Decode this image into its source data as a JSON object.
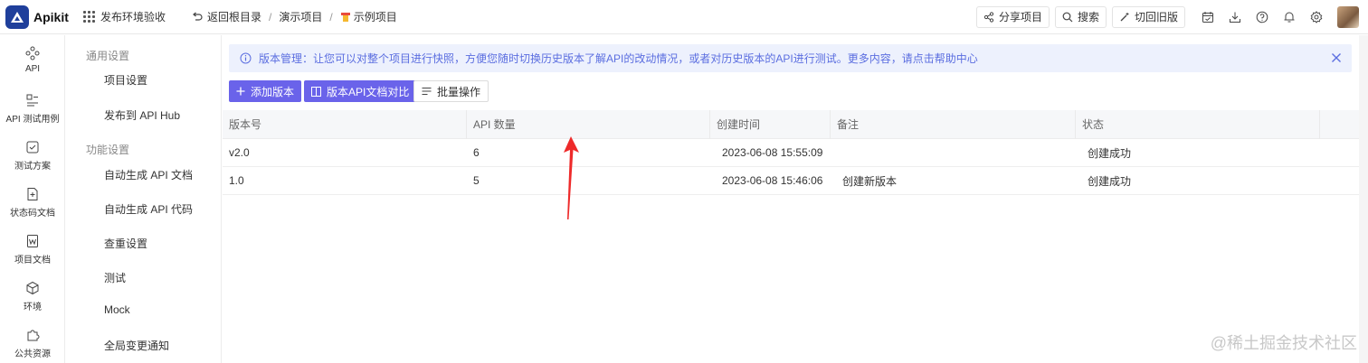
{
  "app": {
    "name": "Apikit"
  },
  "topbar": {
    "env": "发布环境验收",
    "back": "返回根目录",
    "breadcrumb": [
      "演示项目",
      "示例项目"
    ],
    "share": "分享项目",
    "search": "搜索",
    "switch_old": "切回旧版"
  },
  "rail": [
    {
      "label": "API",
      "icon": "api-icon"
    },
    {
      "label": "API 测试用例",
      "icon": "test-case-icon"
    },
    {
      "label": "测试方案",
      "icon": "test-plan-icon"
    },
    {
      "label": "状态码文档",
      "icon": "status-code-icon"
    },
    {
      "label": "项目文档",
      "icon": "word-doc-icon"
    },
    {
      "label": "环境",
      "icon": "environment-icon"
    },
    {
      "label": "公共资源",
      "icon": "puzzle-icon"
    }
  ],
  "settings": {
    "general_title": "通用设置",
    "general": [
      "项目设置",
      "发布到 API Hub"
    ],
    "feature_title": "功能设置",
    "feature": [
      "自动生成 API 文档",
      "自动生成 API 代码",
      "查重设置",
      "测试",
      "Mock",
      "全局变更通知"
    ]
  },
  "notice": {
    "text": "版本管理：让您可以对整个项目进行快照，方便您随时切换历史版本了解API的改动情况，或者对历史版本的API进行测试。更多内容，请点击帮助中心"
  },
  "actions": {
    "add_version": "添加版本",
    "compare": "版本API文档对比",
    "batch": "批量操作"
  },
  "table": {
    "headers": [
      "版本号",
      "API 数量",
      "创建时间",
      "备注",
      "状态",
      ""
    ],
    "rows": [
      [
        "v2.0",
        "6",
        "2023-06-08 15:55:09",
        "",
        "创建成功"
      ],
      [
        "1.0",
        "5",
        "2023-06-08 15:46:06",
        "创建新版本",
        "创建成功"
      ]
    ]
  },
  "watermark": "@稀土掘金技术社区",
  "colors": {
    "primary": "#6a63ea",
    "notice_bg": "#edf1fd",
    "notice_text": "#5b6ee0",
    "arrow": "#ee2a2a"
  }
}
